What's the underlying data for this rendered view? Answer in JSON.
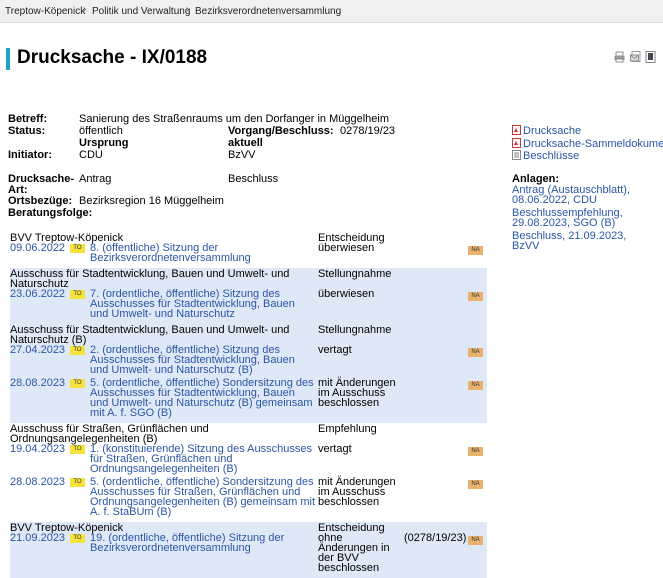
{
  "breadcrumb": [
    "Treptow-Köpenick",
    "Politik und Verwaltung",
    "Bezirksverordnetenversammlung"
  ],
  "title": "Drucksache - IX/0188",
  "toolbar_icons": [
    "print-icon",
    "mail-icon",
    "bookmark-icon"
  ],
  "meta": {
    "betreff_label": "Betreff:",
    "betreff": "Sanierung des Straßenraums um den Dorfanger in Müggelheim",
    "status_label": "Status:",
    "status": "öffentlich",
    "vorgang_label": "Vorgang/Beschluss:",
    "vorgang": "0278/19/23",
    "ursprung_label": "Ursprung",
    "aktuell_label": "aktuell",
    "initiator_label": "Initiator:",
    "initiator": "CDU",
    "aktuell": "BzVV",
    "drucksache_art_label": "Drucksache-",
    "drucksache_art_label2": "Art:",
    "drucksache_art": "Antrag",
    "drucksache_art_aktuell": "Beschluss",
    "ortsbezuege_label": "Ortsbezüge:",
    "ortsbezuege": "Bezirksregion 16 Müggelheim",
    "beratungsfolge_label": "Beratungsfolge:"
  },
  "sidebar": {
    "files": [
      "Drucksache",
      "Drucksache-Sammeldokument",
      "Beschlüsse"
    ],
    "anlagen_label": "Anlagen:",
    "anlagen": [
      [
        "Antrag (Austauschblatt),",
        "08.06.2022, CDU"
      ],
      [
        "Beschlussempfehlung,",
        "29.08.2023, SGO (B)"
      ],
      [
        "Beschluss, 21.09.2023,",
        "BzVV"
      ]
    ]
  },
  "badges": {
    "to": "TO",
    "na": "NA"
  },
  "beratungsfolge": [
    {
      "gremium": [
        "BVV Treptow-Köpenick"
      ],
      "rolle": "Entscheidung",
      "band": false,
      "sessions": [
        {
          "date": "09.06.2022",
          "title": [
            "8. (öffentliche) Sitzung der",
            "Bezirksverordnetenversammlung"
          ],
          "result": [
            "überwiesen"
          ],
          "ref": ""
        }
      ]
    },
    {
      "gremium": [
        "Ausschuss für Stadtentwicklung, Bauen und Umwelt- und",
        "Naturschutz"
      ],
      "rolle": "Stellungnahme",
      "band": true,
      "sessions": [
        {
          "date": "23.06.2022",
          "title": [
            "7. (ordentliche, öffentliche) Sitzung des",
            "Ausschusses für Stadtentwicklung, Bauen",
            "und Umwelt- und Naturschutz"
          ],
          "result": [
            "überwiesen"
          ],
          "ref": ""
        }
      ]
    },
    {
      "gremium": [
        "Ausschuss für Stadtentwicklung, Bauen und Umwelt- und",
        "Naturschutz (B)"
      ],
      "rolle": "Stellungnahme",
      "band": true,
      "sessions": [
        {
          "date": "27.04.2023",
          "title": [
            "2. (ordentliche, öffentliche) Sitzung des",
            "Ausschusses für Stadtentwicklung, Bauen",
            "und Umwelt- und Naturschutz (B)"
          ],
          "result": [
            "vertagt"
          ],
          "ref": ""
        },
        {
          "date": "28.08.2023",
          "title": [
            "5. (ordentliche, öffentliche) Sondersitzung des",
            "Ausschusses für Stadtentwicklung, Bauen",
            "und Umwelt- und Naturschutz (B) gemeinsam",
            "mit A. f. SGO (B)"
          ],
          "result": [
            "mit Änderungen",
            "im Ausschuss",
            "beschlossen"
          ],
          "ref": ""
        }
      ]
    },
    {
      "gremium": [
        "Ausschuss für Straßen, Grünflächen und",
        "Ordnungsangelegenheiten (B)"
      ],
      "rolle": "Empfehlung",
      "band": false,
      "sessions": [
        {
          "date": "19.04.2023",
          "title": [
            "1. (konstituierende) Sitzung des Ausschusses",
            "für Straßen, Grünflächen und",
            "Ordnungsangelegenheiten (B)"
          ],
          "result": [
            "vertagt"
          ],
          "ref": ""
        },
        {
          "date": "28.08.2023",
          "title": [
            "5. (ordentliche, öffentliche) Sondersitzung des",
            "Ausschusses für Straßen, Grünflächen und",
            "Ordnungsangelegenheiten (B) gemeinsam mit",
            "A. f. StaBUm (B)"
          ],
          "result": [
            "mit Änderungen",
            "im Ausschuss",
            "beschlossen"
          ],
          "ref": ""
        }
      ]
    },
    {
      "gremium": [
        "BVV Treptow-Köpenick"
      ],
      "rolle": "Entscheidung",
      "band": true,
      "sessions": [
        {
          "date": "21.09.2023",
          "title": [
            "19. (ordentliche, öffentliche) Sitzung der",
            "Bezirksverordnetenversammlung"
          ],
          "result": [
            "ohne",
            "Änderungen in",
            "der BVV",
            "beschlossen"
          ],
          "ref": "(0278/19/23)"
        }
      ]
    }
  ]
}
